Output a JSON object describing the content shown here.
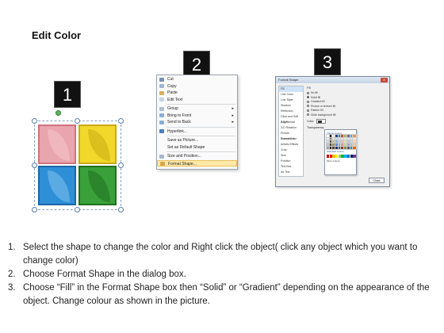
{
  "title": "Edit Color",
  "badges": [
    "1",
    "2",
    "3"
  ],
  "context_menu": {
    "items": [
      {
        "label": "Cut",
        "icon": "scissors-icon",
        "color": "#7a8fb3"
      },
      {
        "label": "Copy",
        "icon": "copy-icon",
        "color": "#9fb5d4"
      },
      {
        "label": "Paste",
        "icon": "paste-icon",
        "color": "#d9b35a"
      },
      {
        "label": "Edit Text",
        "icon": "edit-text-icon",
        "color": "#c8d3e2"
      },
      {
        "label": "Group",
        "icon": "group-icon",
        "color": "#b0bcd0",
        "submenu": true
      },
      {
        "label": "Bring to Front",
        "icon": "bring-front-icon",
        "color": "#8ab0d8",
        "submenu": true
      },
      {
        "label": "Send to Back",
        "icon": "send-back-icon",
        "color": "#8ab0d8",
        "submenu": true
      },
      {
        "label": "Hyperlink...",
        "icon": "hyperlink-icon",
        "color": "#4a7fc0"
      },
      {
        "label": "Save as Picture...",
        "icon": "",
        "color": ""
      },
      {
        "label": "Set as Default Shape",
        "icon": "",
        "color": ""
      },
      {
        "label": "Size and Position...",
        "icon": "size-icon",
        "color": "#a8b8cc"
      },
      {
        "label": "Format Shape...",
        "icon": "format-shape-icon",
        "color": "#d9a54a",
        "highlighted": true
      }
    ]
  },
  "dialog": {
    "title": "Format Shape",
    "close_label": "X",
    "sidebar": [
      "Fill",
      "Line Color",
      "Line Style",
      "Shadow",
      "Reflection",
      "Glow and Soft Edges",
      "3-D Format",
      "3-D Rotation",
      "Picture Corrections",
      "Picture Color",
      "Artistic Effects",
      "Crop",
      "Size",
      "Position",
      "Text Box",
      "Alt Text"
    ],
    "section_header": "Fill",
    "fill_options": [
      "No fill",
      "Solid fill",
      "Gradient fill",
      "Picture or texture fill",
      "Pattern fill",
      "Slide background fill"
    ],
    "fill_selected_index": 1,
    "color_label": "Color:",
    "transparency_label": "Transparency:",
    "palette_theme_label": "Theme Colors",
    "palette_standard_label": "Standard Colors",
    "palette_more_label": "More Colors...",
    "close_button": "Close",
    "theme_colors": [
      "#ffffff",
      "#000000",
      "#eeece1",
      "#1f497d",
      "#4f81bd",
      "#c0504d",
      "#9bbb59",
      "#8064a2",
      "#4bacc6",
      "#f79646",
      "#f2f2f2",
      "#7f7f7f",
      "#ddd9c3",
      "#c6d9f0",
      "#dbe5f1",
      "#f2dcdb",
      "#ebf1dd",
      "#e5e0ec",
      "#dbeef3",
      "#fdeada",
      "#d8d8d8",
      "#595959",
      "#c4bd97",
      "#8db3e2",
      "#b8cce4",
      "#e5b9b7",
      "#d7e3bc",
      "#ccc1d9",
      "#b7dde8",
      "#fbd5b5",
      "#bfbfbf",
      "#3f3f3f",
      "#938953",
      "#548dd4",
      "#95b3d7",
      "#d99694",
      "#c3d69b",
      "#b2a2c7",
      "#92cddc",
      "#fac08f",
      "#a5a5a5",
      "#262626",
      "#494429",
      "#17365d",
      "#366092",
      "#953734",
      "#76923c",
      "#5f497a",
      "#31859b",
      "#e36c09"
    ],
    "standard_colors": [
      "#c00000",
      "#ff0000",
      "#ffc000",
      "#ffff00",
      "#92d050",
      "#00b050",
      "#00b0f0",
      "#0070c0",
      "#002060",
      "#7030a0"
    ]
  },
  "instructions": [
    {
      "num": "1.",
      "text": "Select the shape to change the color and Right click the object( click any object which you want to change color)"
    },
    {
      "num": "2.",
      "text": "Choose Format Shape in the dialog box."
    },
    {
      "num": "3.",
      "text": "Choose “Fill” in the Format Shape box then “Solid” or “Gradient” depending on the appearance of the object. Change colour as shown in the picture."
    }
  ]
}
